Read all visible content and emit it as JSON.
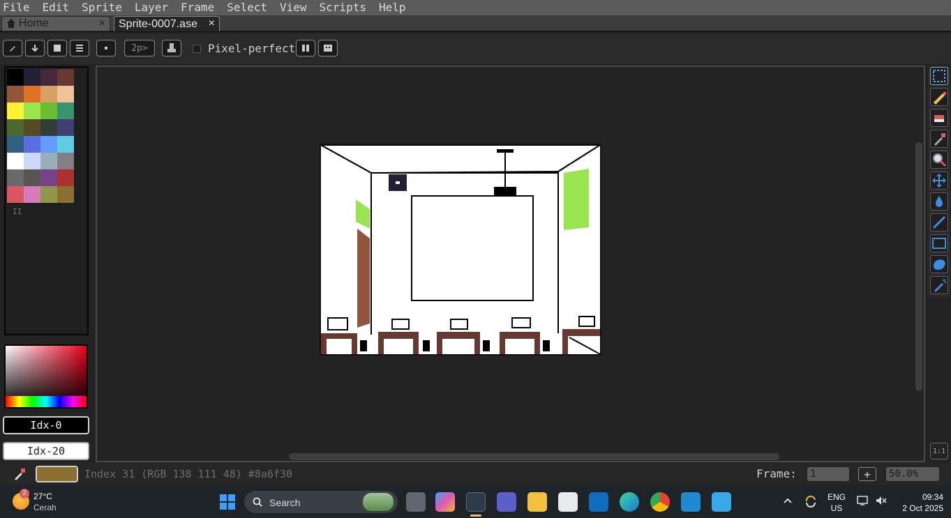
{
  "menu": {
    "items": [
      {
        "label": "File"
      },
      {
        "label": "Edit"
      },
      {
        "label": "Sprite"
      },
      {
        "label": "Layer"
      },
      {
        "label": "Frame"
      },
      {
        "label": "Select"
      },
      {
        "label": "View"
      },
      {
        "label": "Scripts"
      },
      {
        "label": "Help"
      }
    ]
  },
  "tabs": {
    "home": {
      "label": "Home",
      "close": "×"
    },
    "sprite": {
      "label": "Sprite-0007.ase",
      "close": "×"
    }
  },
  "toolbar": {
    "brush_size": "2p>",
    "pixel_perfect_label": "Pixel-perfect"
  },
  "palette": {
    "colors": [
      "#000000",
      "#222034",
      "#45283c",
      "#663931",
      "#8f563b",
      "#df7126",
      "#d9a066",
      "#eec39a",
      "#fbf236",
      "#99e550",
      "#6abe30",
      "#37946e",
      "#4b692f",
      "#524b24",
      "#323c39",
      "#3f3f74",
      "#306082",
      "#5b6ee1",
      "#639bff",
      "#5fcde4",
      "#ffffff",
      "#cbdbfc",
      "#9badb7",
      "#847e87",
      "#696a6a",
      "#595652",
      "#76428a",
      "#ac3232",
      "#d95763",
      "#d77bba",
      "#8f974a",
      "#8a6f30"
    ],
    "extra": "II"
  },
  "colorbar": {
    "fg_label": "Idx-0",
    "bg_label": "Idx-20"
  },
  "status": {
    "fg_color": "#8a6f30",
    "text": "Index 31 (RGB 138 111 48) #8a6f30",
    "frame_label": "Frame:",
    "frame_value": "1",
    "add_frame": "+",
    "zoom": "50.0%",
    "one_to_one": "1:1"
  },
  "taskbar": {
    "weather_badge": "2",
    "temperature": "27°C",
    "condition": "Cerah",
    "search_label": "Search",
    "lang_line1": "ENG",
    "lang_line2": "US",
    "time": "09:34",
    "date": "2 Oct 2025"
  }
}
